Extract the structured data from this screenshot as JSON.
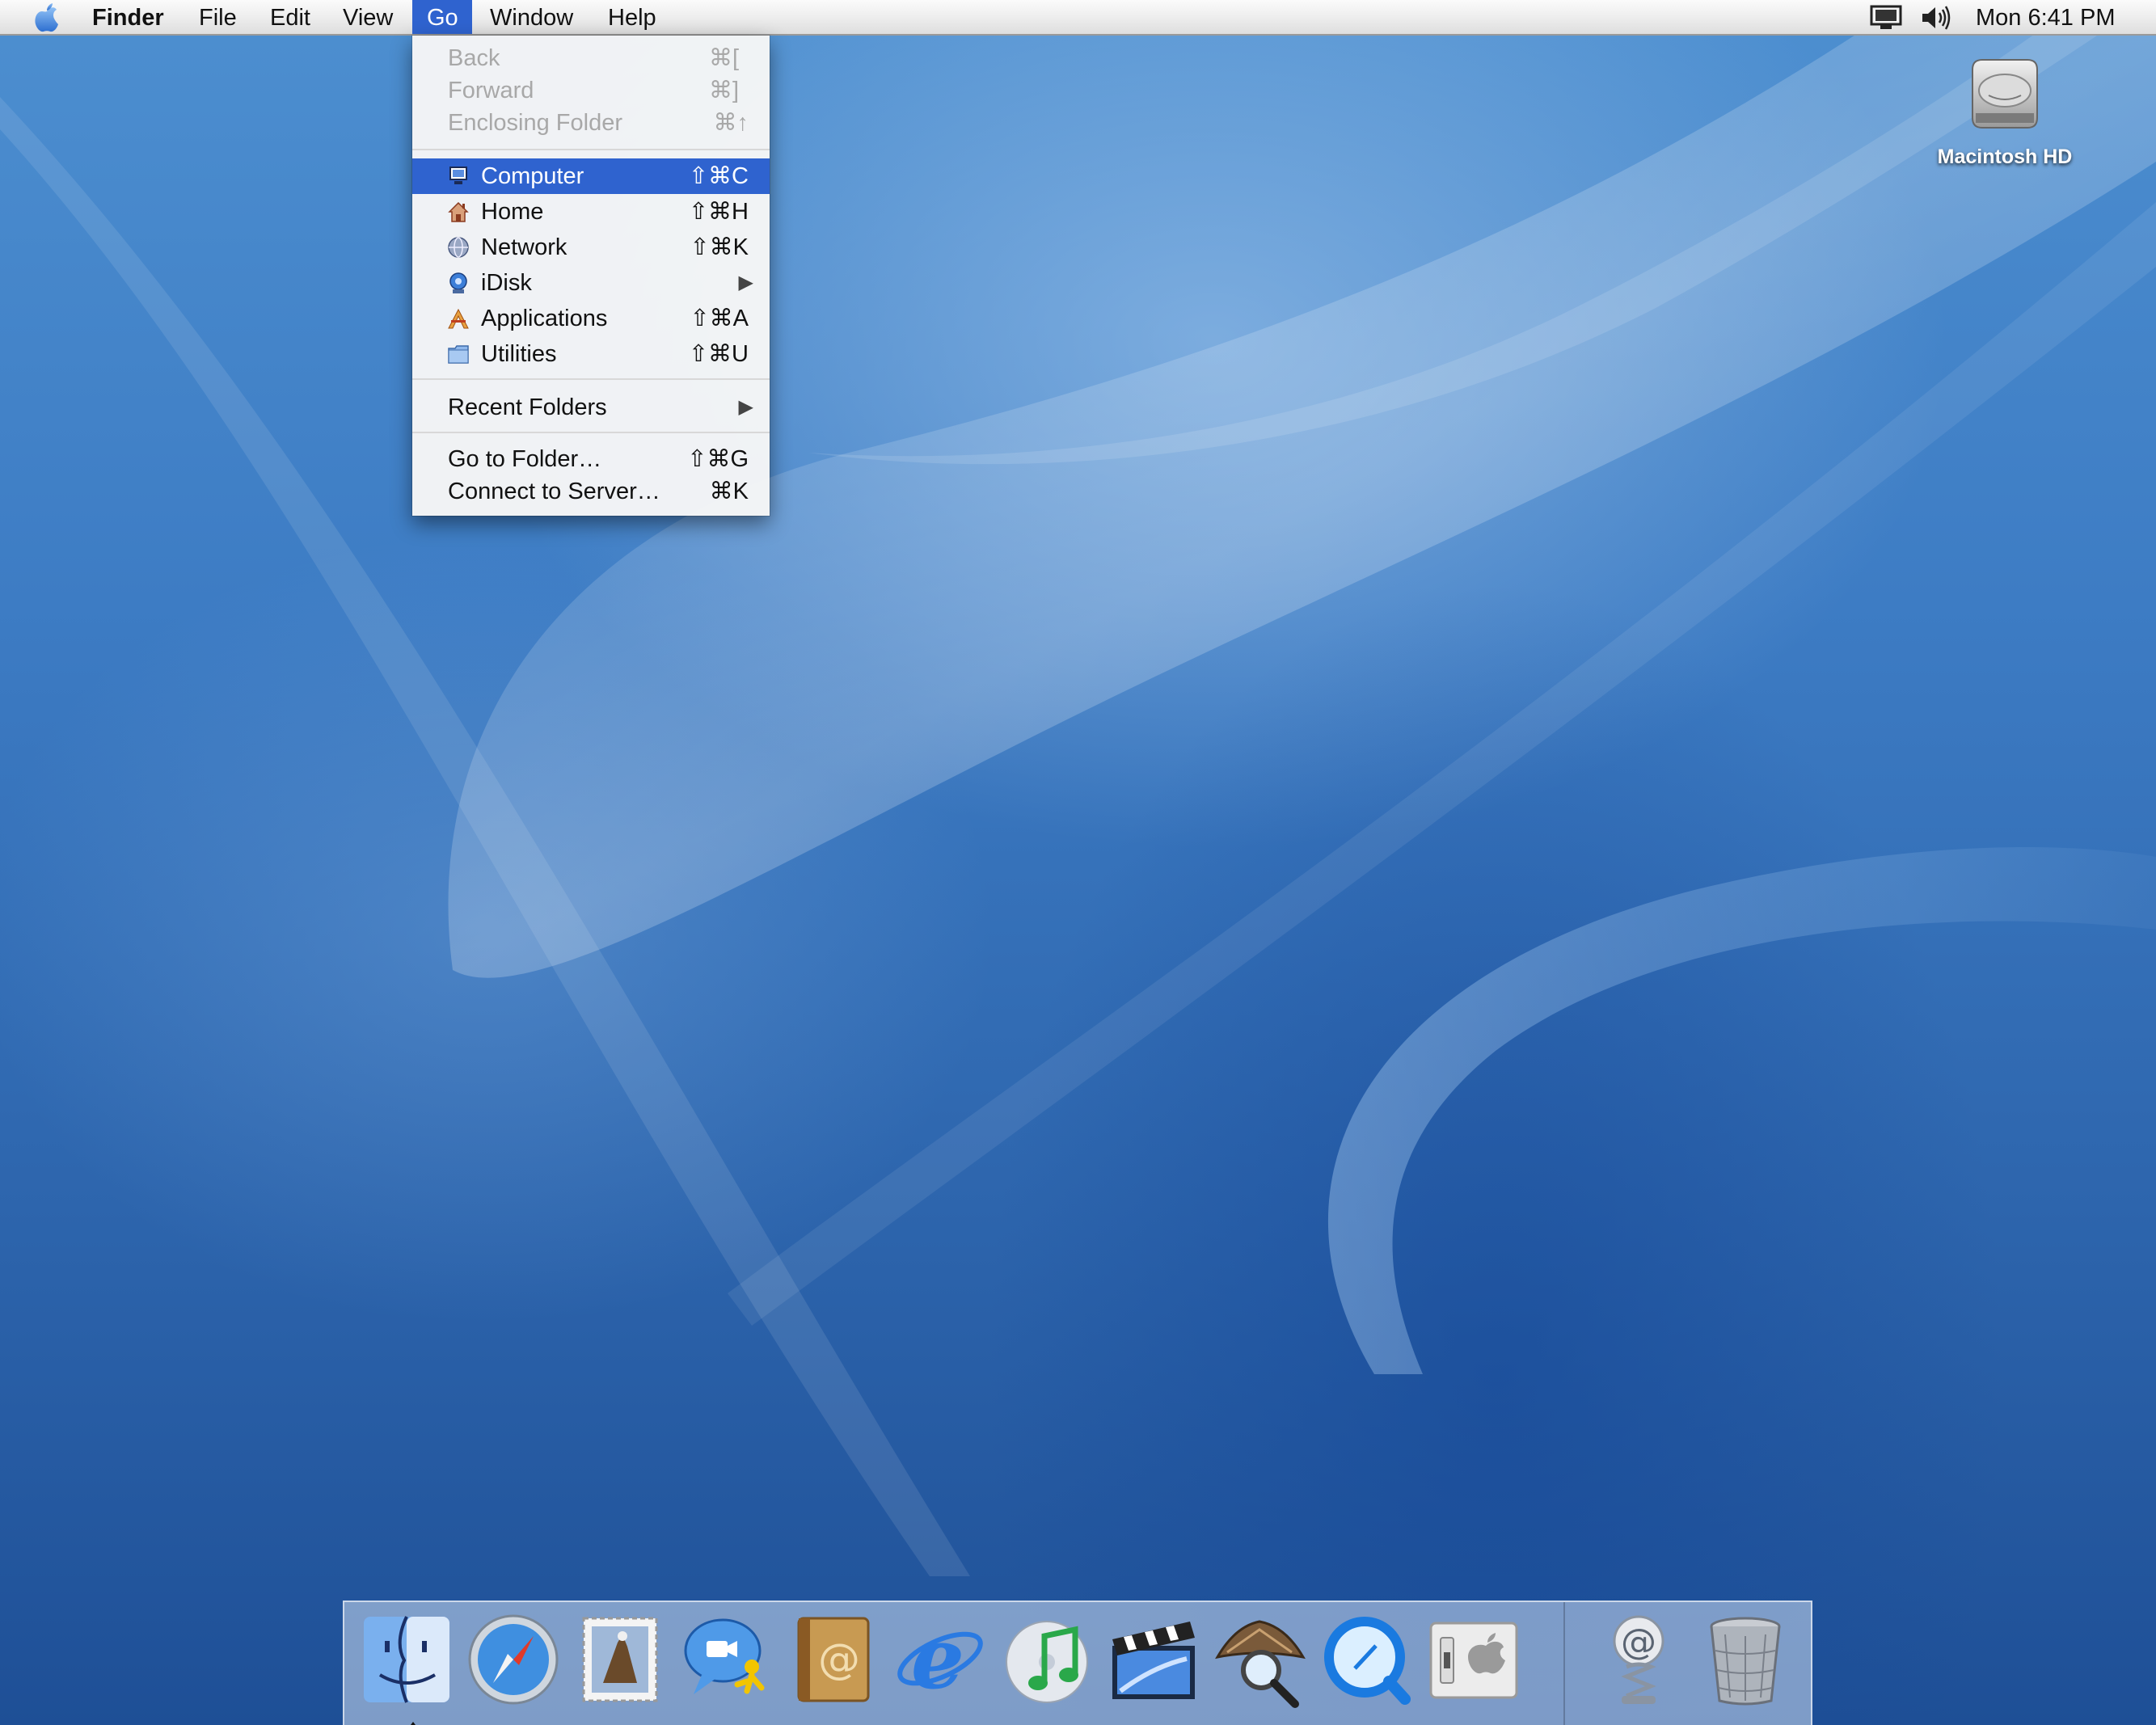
{
  "menubar": {
    "apple_icon": "apple-icon",
    "app_name": "Finder",
    "menus": [
      "File",
      "Edit",
      "View",
      "Go",
      "Window",
      "Help"
    ],
    "active_menu": "Go",
    "status_icons": [
      "display-icon",
      "volume-icon"
    ],
    "clock": "Mon 6:41 PM"
  },
  "go_menu": {
    "items": [
      {
        "label": "Back",
        "shortcut": "⌘[",
        "enabled": false
      },
      {
        "label": "Forward",
        "shortcut": "⌘]",
        "enabled": false
      },
      {
        "label": "Enclosing Folder",
        "shortcut": "⌘↑",
        "enabled": false
      },
      {
        "label": "Computer",
        "shortcut": "⇧⌘C",
        "icon": "computer-icon",
        "highlighted": true
      },
      {
        "label": "Home",
        "shortcut": "⇧⌘H",
        "icon": "home-icon"
      },
      {
        "label": "Network",
        "shortcut": "⇧⌘K",
        "icon": "network-icon"
      },
      {
        "label": "iDisk",
        "shortcut": "",
        "icon": "idisk-icon",
        "submenu": true
      },
      {
        "label": "Applications",
        "shortcut": "⇧⌘A",
        "icon": "applications-icon"
      },
      {
        "label": "Utilities",
        "shortcut": "⇧⌘U",
        "icon": "utilities-folder-icon"
      },
      {
        "label": "Recent Folders",
        "shortcut": "",
        "submenu": true
      },
      {
        "label": "Go to Folder…",
        "shortcut": "⇧⌘G"
      },
      {
        "label": "Connect to Server…",
        "shortcut": "⌘K"
      }
    ]
  },
  "desktop": {
    "hd_label": "Macintosh HD",
    "hd_icon": "hard-drive-icon"
  },
  "dock": {
    "items": [
      "finder-icon",
      "safari-icon",
      "mail-icon",
      "ichat-icon",
      "address-book-icon",
      "internet-explorer-icon",
      "itunes-icon",
      "imovie-icon",
      "sherlock-icon",
      "quicktime-icon",
      "system-preferences-icon",
      "mail-at-icon",
      "trash-icon"
    ],
    "running": [
      "finder-icon"
    ]
  },
  "colors": {
    "highlight": "#2f63cf",
    "desktop_blue": "#3d7cc4",
    "menubar": "#ececec"
  }
}
